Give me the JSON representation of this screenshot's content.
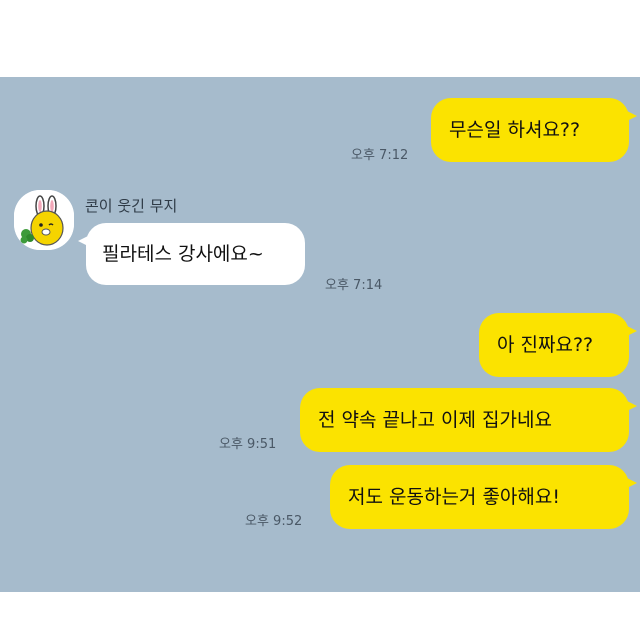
{
  "chat": {
    "sender_name": "콘이 웃긴 무지",
    "messages": [
      {
        "text": "무슨일 하셔요??",
        "time": "오후 7:12",
        "from": "me"
      },
      {
        "text": "필라테스 강사에요~",
        "time": "오후 7:14",
        "from": "them"
      },
      {
        "text": "아 진짜요??",
        "time": "",
        "from": "me"
      },
      {
        "text": "전 약속 끝나고 이제 집가네요",
        "time": "오후 9:51",
        "from": "me"
      },
      {
        "text": "저도 운동하는거 좋아해요!",
        "time": "오후 9:52",
        "from": "me"
      }
    ]
  },
  "colors": {
    "chat_background": "#a6bbcc",
    "my_bubble": "#fbe300",
    "their_bubble": "#ffffff"
  },
  "avatar_icon": "muzi-character-avatar-icon"
}
